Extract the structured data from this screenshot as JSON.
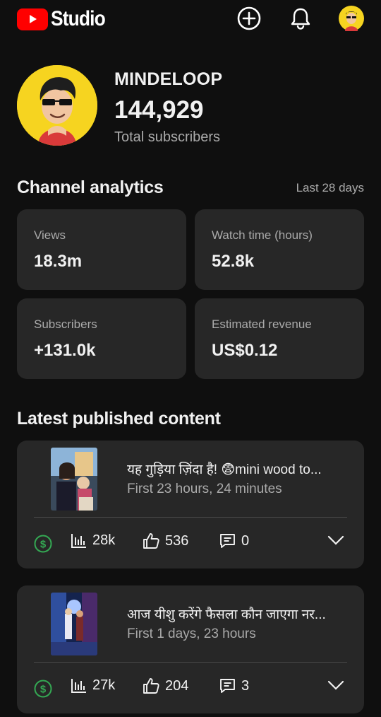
{
  "app": {
    "name": "Studio",
    "logo_icon": "youtube-play-icon"
  },
  "header": {
    "actions": [
      {
        "name": "create-icon"
      },
      {
        "name": "notifications-icon"
      },
      {
        "name": "account-avatar"
      }
    ]
  },
  "channel": {
    "name": "MINDELOOP",
    "subscribers": "144,929",
    "subscribers_label": "Total subscribers"
  },
  "analytics": {
    "title": "Channel analytics",
    "period": "Last 28 days",
    "cards": [
      {
        "label": "Views",
        "value": "18.3m"
      },
      {
        "label": "Watch time (hours)",
        "value": "52.8k"
      },
      {
        "label": "Subscribers",
        "value": "+131.0k"
      },
      {
        "label": "Estimated revenue",
        "value": "US$0.12"
      }
    ]
  },
  "latest": {
    "title": "Latest published content",
    "videos": [
      {
        "title": "यह गुड़िया ज़िंदा है! 😨mini wood to...",
        "subtitle": "First 23 hours, 24 minutes",
        "views": "28k",
        "likes": "536",
        "comments": "0"
      },
      {
        "title": "आज यीशु करेंगे फैसला कौन जाएगा नर...",
        "subtitle": "First 1 days, 23 hours",
        "views": "27k",
        "likes": "204",
        "comments": "3"
      }
    ]
  },
  "colors": {
    "background": "#0f0f0f",
    "card": "#272727",
    "brand_red": "#ff0000",
    "monetized_green": "#34a853",
    "muted_text": "#aaaaaa"
  }
}
